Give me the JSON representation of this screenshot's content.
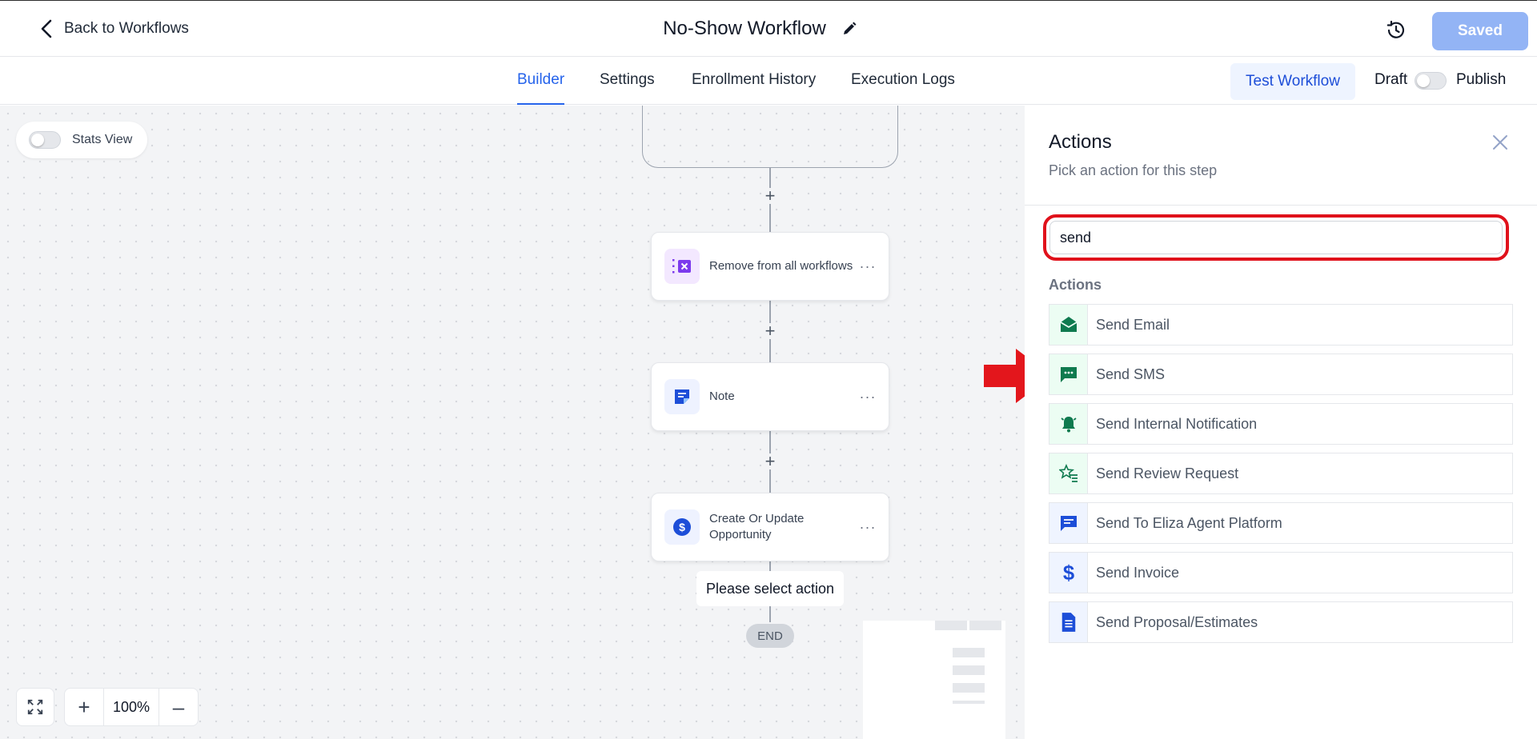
{
  "header": {
    "back_label": "Back to Workflows",
    "title": "No-Show Workflow",
    "saved_label": "Saved"
  },
  "tabs": [
    {
      "label": "Builder",
      "active": true
    },
    {
      "label": "Settings",
      "active": false
    },
    {
      "label": "Enrollment History",
      "active": false
    },
    {
      "label": "Execution Logs",
      "active": false
    }
  ],
  "toolbar": {
    "test_label": "Test Workflow",
    "draft_label": "Draft",
    "publish_label": "Publish",
    "publish_on": false
  },
  "canvas": {
    "stats_label": "Stats View",
    "stats_on": false,
    "nodes": [
      {
        "label": "Remove from all workflows",
        "icon": "remove-workflow-icon"
      },
      {
        "label": "Note",
        "icon": "note-icon"
      },
      {
        "label": "Create Or Update Opportunity",
        "icon": "dollar-icon"
      }
    ],
    "tooltip": "Please select action",
    "end_label": "END",
    "zoom": "100%",
    "zoom_in": "+",
    "zoom_out": "–"
  },
  "panel": {
    "title": "Actions",
    "subtitle": "Pick an action for this step",
    "search_value": "send",
    "section_label": "Actions",
    "items": [
      {
        "label": "Send Email",
        "icon": "email-icon"
      },
      {
        "label": "Send SMS",
        "icon": "sms-icon"
      },
      {
        "label": "Send Internal Notification",
        "icon": "bell-icon"
      },
      {
        "label": "Send Review Request",
        "icon": "star-list-icon"
      },
      {
        "label": "Send To Eliza Agent Platform",
        "icon": "chat-icon"
      },
      {
        "label": "Send Invoice",
        "icon": "dollar-sign-icon"
      },
      {
        "label": "Send Proposal/Estimates",
        "icon": "document-icon"
      }
    ]
  },
  "colors": {
    "accent": "#2563eb",
    "highlight": "#e0111b",
    "saved_button": "#93b4f5"
  }
}
